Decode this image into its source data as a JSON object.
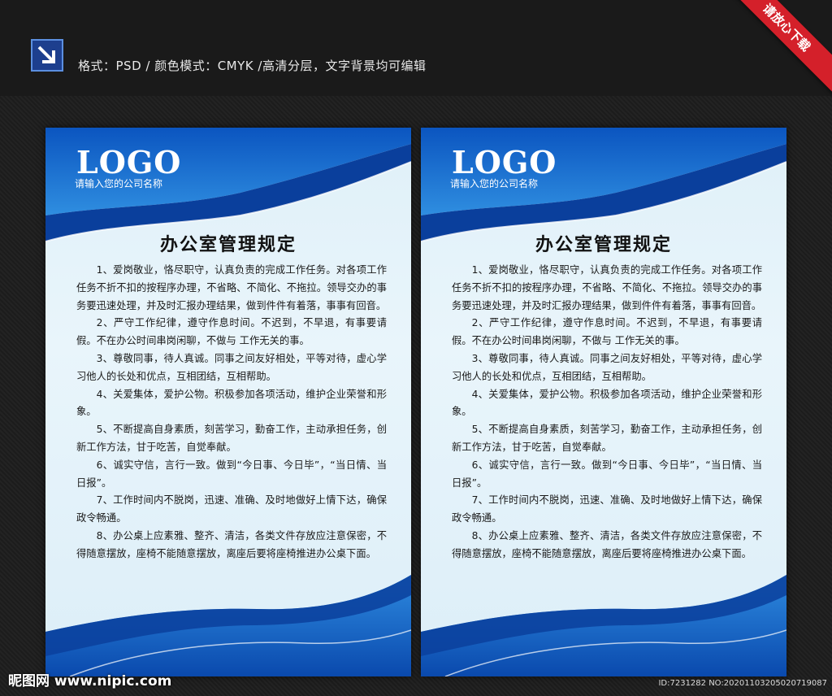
{
  "header": {
    "info_text": "格式：PSD  /  颜色模式：CMYK  /高清分层，文字背景均可编辑",
    "ribbon_text": "请放心下载",
    "icon": "arrow-down-right-icon"
  },
  "poster": {
    "logo": "LOGO",
    "company": "请输入您的公司名称",
    "title": "办公室管理规定",
    "paragraphs": [
      "1、爱岗敬业，恪尽职守，认真负责的完成工作任务。对各项工作任务不折不扣的按程序办理，不省略、不简化、不拖拉。领导交办的事务要迅速处理，并及时汇报办理结果，做到件件有着落，事事有回音。",
      "2、严守工作纪律，遵守作息时间。不迟到，不早退，有事要请假。不在办公时间串岗闲聊，不做与  工作无关的事。",
      "3、尊敬同事，待人真诚。同事之间友好相处，平等对待，虚心学习他人的长处和优点，互相团结，互相帮助。",
      "4、关爱集体，爱护公物。积极参加各项活动，维护企业荣誉和形象。",
      "5、不断提高自身素质，刻苦学习，勤奋工作，主动承担任务，创新工作方法，甘于吃苦，自觉奉献。",
      "6、诚实守信，言行一致。做到“今日事、今日毕”，“当日情、当日报”。",
      "7、工作时间内不脱岗，迅速、准确、及时地做好上情下达，确保政令畅通。",
      "8、办公桌上应素雅、整齐、清洁，各类文件存放应注意保密，不得随意摆放，座椅不能随意摆放，离座后要将座椅推进办公桌下面。"
    ]
  },
  "footer": {
    "watermark": "昵图网 www.nipic.com",
    "id_text": "ID:7231282 NO:20201103205020719087"
  },
  "colors": {
    "primary_blue": "#0a4fb0",
    "dark_blue": "#062f7a",
    "light_bg": "#e6f3fa",
    "ribbon_red": "#d4202a"
  }
}
